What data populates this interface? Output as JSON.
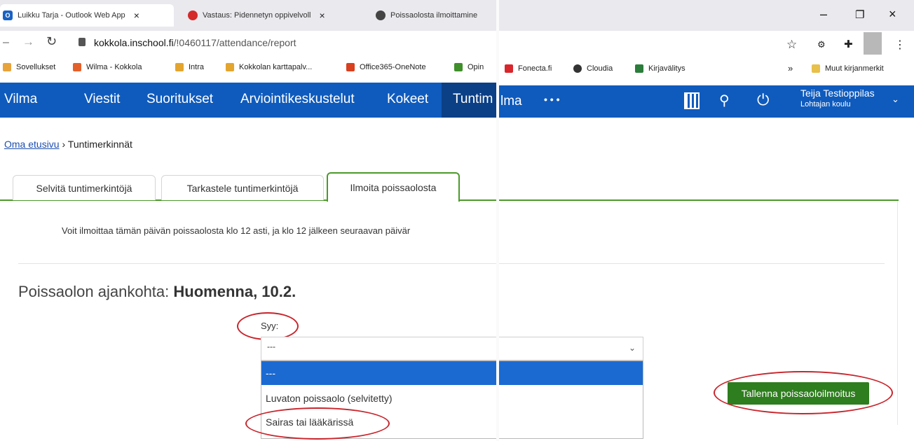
{
  "browser": {
    "tabs": [
      {
        "title": "Luikku Tarja - Outlook Web App",
        "icon": "outlook-icon"
      },
      {
        "title": "Vastaus: Pidennetyn oppivelvoll",
        "icon": "mail-reply-icon"
      },
      {
        "title": "Poissaolosta ilmoittamine",
        "icon": "globe-icon"
      }
    ],
    "close_glyph": "×",
    "url_host": "kokkola.inschool.fi",
    "url_path": "/!0460117/attendance/report",
    "bookmarks_left": [
      {
        "label": "Sovellukset",
        "color": "#e8a33b"
      },
      {
        "label": "Wilma - Kokkola",
        "color": "#e4602a"
      },
      {
        "label": "Intra",
        "color": "#e3a52e"
      },
      {
        "label": "Kokkolan karttapalv...",
        "color": "#e3a52e"
      },
      {
        "label": "Office365-OneNote",
        "color": "#d8401e"
      },
      {
        "label": "Opin",
        "color": "#3f8f2a"
      }
    ],
    "bookmarks_right": [
      {
        "label": "Fonecta.fi",
        "color": "#d8262c"
      },
      {
        "label": "Cloudia",
        "color": "#333333"
      },
      {
        "label": "Kirjavälitys",
        "color": "#2a7d3a"
      }
    ],
    "bookmarks_more": "»",
    "other_bookmarks": "Muut kirjanmerkit"
  },
  "wilma": {
    "logo": "Vilma",
    "logo_right": "lma",
    "nav": [
      "Viestit",
      "Suoritukset",
      "Arviointikeskustelut",
      "Kokeet",
      "Tuntim"
    ],
    "more": "• • •",
    "user_name": "Teija Testioppilas",
    "school": "Lohtajan koulu"
  },
  "breadcrumb": {
    "home": "Oma etusivu",
    "separator": "›",
    "current": "Tuntimerkinnät"
  },
  "tabs": [
    "Selvitä tuntimerkintöjä",
    "Tarkastele tuntimerkintöjä",
    "Ilmoita poissaolosta"
  ],
  "info": "Voit ilmoittaa tämän päivän poissaolosta klo 12 asti, ja klo 12 jälkeen seuraavan päivär",
  "when": {
    "label": "Poissaolon ajankohta:",
    "value": "Huomenna, 10.2."
  },
  "reason": {
    "label": "Syy:",
    "selected": "---",
    "options": [
      "---",
      "Luvaton poissaolo (selvitetty)",
      "Sairas tai lääkärissä"
    ]
  },
  "save_button": "Tallenna poissaoloilmoitus",
  "colors": {
    "nav": "#0f5bbd",
    "green": "#4c9a2a",
    "annotation": "#c8252c",
    "selected": "#1b6ad2"
  }
}
